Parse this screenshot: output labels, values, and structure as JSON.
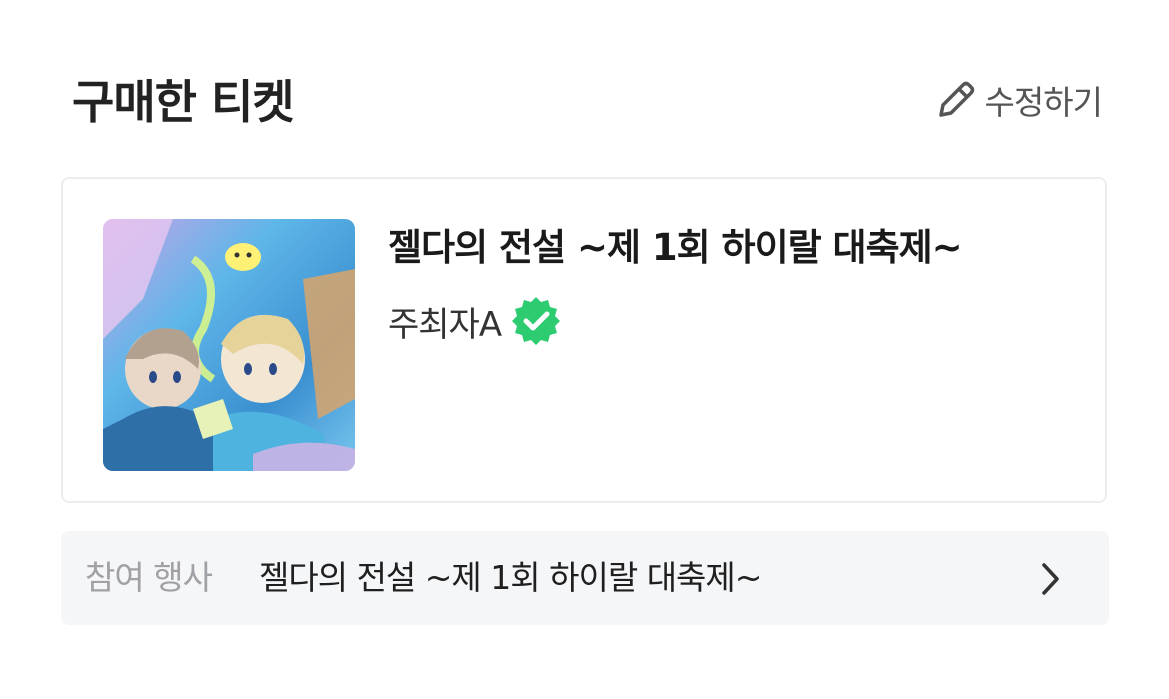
{
  "section": {
    "title": "구매한 티켓",
    "edit_label": "수정하기"
  },
  "ticket": {
    "title": "젤다의 전설 ~제 1회 하이랄 대축제~",
    "organizer": "주최자A",
    "thumbnail_icon": "event-artwork",
    "verified_color": "#2ecc71"
  },
  "event": {
    "label": "참여 행사",
    "name": "젤다의 전설 ~제 1회 하이랄 대축제~"
  },
  "colors": {
    "title_text": "#222222",
    "secondary_text": "#555555",
    "muted_label": "#a0a0a6",
    "card_border": "#ececef",
    "event_row_bg": "#f5f6f8"
  }
}
